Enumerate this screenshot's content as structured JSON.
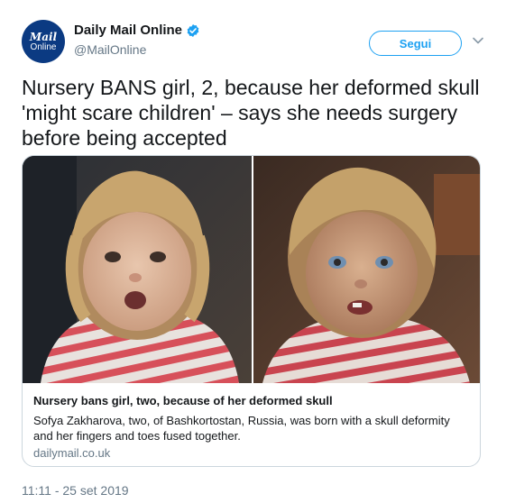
{
  "author": {
    "avatar_line1": "Mail",
    "avatar_line2": "Online",
    "display_name": "Daily Mail Online",
    "handle": "@MailOnline",
    "verified_icon": "verified-badge-icon"
  },
  "follow_button": {
    "label": "Segui"
  },
  "tweet": {
    "text": "Nursery BANS girl, 2, because her deformed skull 'might scare children' – says she needs surgery before being accepted",
    "timestamp": "11:11 - 25 set 2019"
  },
  "card": {
    "title": "Nursery bans girl, two, because of her deformed skull",
    "description": "Sofya Zakharova, two, of Bashkortostan, Russia, was born with a skull deformity and her fingers and toes fused together.",
    "domain": "dailymail.co.uk"
  },
  "colors": {
    "accent": "#1da1f2",
    "text": "#14171a",
    "muted": "#657786",
    "border": "#ccd6dd",
    "avatar_bg": "#0b3a82"
  }
}
